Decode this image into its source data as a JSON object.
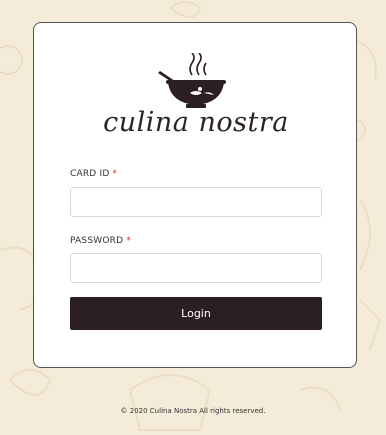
{
  "brand": {
    "name": "culina nostra",
    "logo_icon": "cooking-pot-icon"
  },
  "form": {
    "card_id": {
      "label": "CARD ID",
      "required_mark": "*",
      "value": "",
      "placeholder": ""
    },
    "password": {
      "label": "PASSWORD",
      "required_mark": "*",
      "value": "",
      "placeholder": ""
    },
    "login_label": "Login"
  },
  "footer": {
    "text": "© 2020 Culina Nostra All rights reserved."
  },
  "colors": {
    "background": "#f4ecd9",
    "button": "#2b1f25",
    "required": "#d9262d",
    "text": "#2c2326"
  }
}
